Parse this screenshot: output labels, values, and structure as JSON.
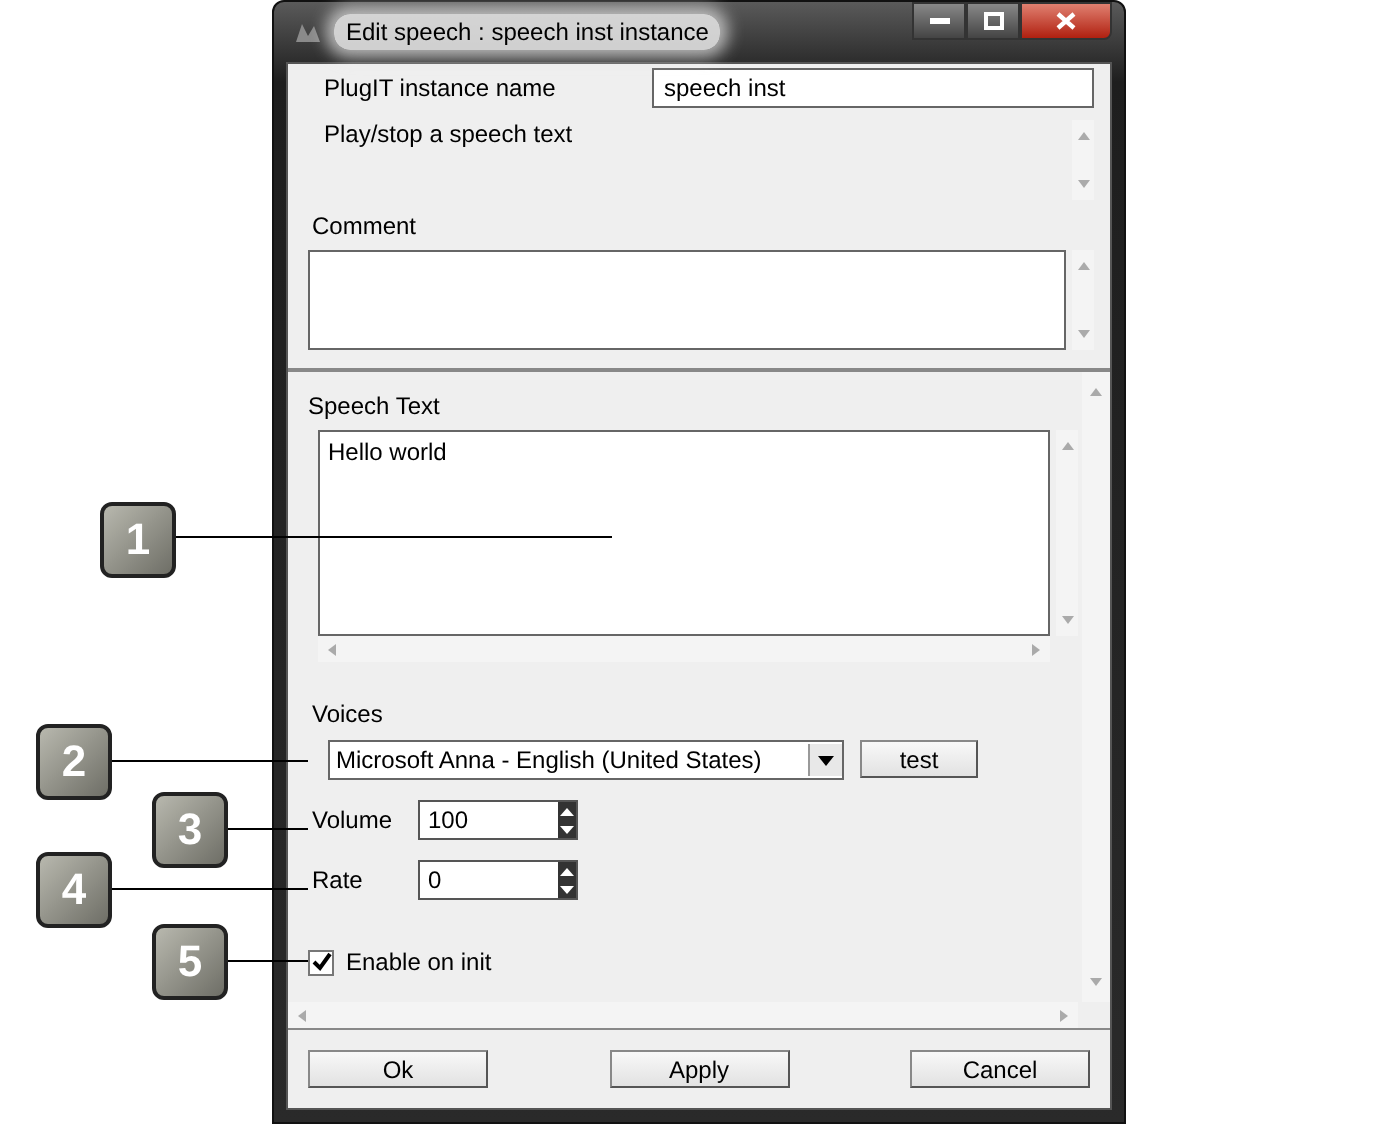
{
  "window": {
    "title": "Edit speech : speech inst instance"
  },
  "instance_name": {
    "label": "PlugIT instance name",
    "value": "speech inst"
  },
  "description": "Play/stop a speech text",
  "comment": {
    "label": "Comment"
  },
  "speech_text": {
    "label": "Speech Text",
    "value": "Hello world"
  },
  "voices": {
    "label": "Voices",
    "value": "Microsoft Anna - English (United States)",
    "test_button": "test"
  },
  "volume": {
    "label": "Volume",
    "value": "100"
  },
  "rate": {
    "label": "Rate",
    "value": "0"
  },
  "enable_on_init": {
    "label": "Enable on init",
    "checked": true
  },
  "buttons": [
    "Ok",
    "Apply",
    "Cancel"
  ],
  "callouts": [
    {
      "label": "1"
    },
    {
      "label": "2"
    },
    {
      "label": "3"
    },
    {
      "label": "4"
    },
    {
      "label": "5"
    }
  ]
}
